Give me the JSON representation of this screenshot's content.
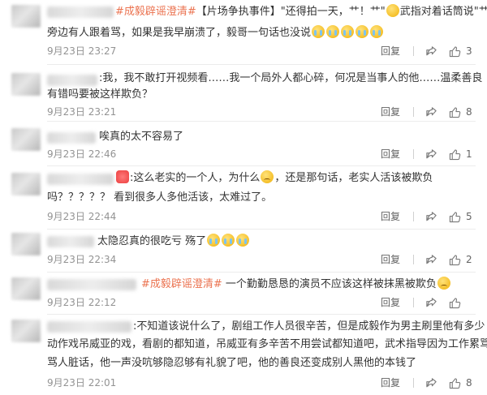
{
  "comments": [
    {
      "text_line1_topic": "#成毅辟谣澄清#",
      "text_line1": "【片场争执事件】\"还得拍一天，艹！艹\"",
      "text_line1_tail": "武指对着话筒说\"艹，",
      "text_line2": "旁边有人跟着骂，如果是我早崩溃了，毅哥一句话也没说",
      "time": "9月23日 23:27",
      "reply": "回复",
      "likes": "3"
    },
    {
      "text_line1": ":我，我不敢打开视频看……我一个局外人都心碎，何况是当事人的他……温柔善良",
      "text_line2": "有错吗要被这样欺负？",
      "time": "9月23日 23:21",
      "reply": "回复",
      "likes": "8"
    },
    {
      "text_line1": "唉真的太不容易了",
      "time": "9月23日 22:46",
      "reply": "回复",
      "likes": "1"
    },
    {
      "text_line1_head": ":这么老实的一个人，为什么",
      "text_line1_tail": "，还是那句话，老实人活该被欺负",
      "text_line2": "吗？？？？？ 看到很多人多他活该，太难过了。",
      "time": "9月23日 22:44",
      "reply": "回复",
      "likes": "5"
    },
    {
      "text_line1": "太隐忍真的很吃亏 殇了",
      "time": "9月23日 22:34",
      "reply": "回复",
      "likes": "2"
    },
    {
      "text_line1_topic": "#成毅辟谣澄清#",
      "text_line1": " 一个勤勤恳恳的演员不应该这样被抹黑被欺负",
      "time": "9月23日 22:12",
      "reply": "回复",
      "likes": ""
    },
    {
      "text_line1": ":不知道该说什么了，剧组工作人员很辛苦，但是成毅作为男主刷里他有多少",
      "text_line2": "动作戏吊威亚的戏，看剧的都知道，吊威亚有多辛苦不用尝试都知道吧，武术指导因为工作累骂他",
      "text_line3": "骂人脏话，他一声没吭够隐忍够有礼貌了吧，他的善良还变成别人黑他的本钱了",
      "time": "9月23日 22:01",
      "reply": "回复",
      "likes": "8"
    }
  ]
}
